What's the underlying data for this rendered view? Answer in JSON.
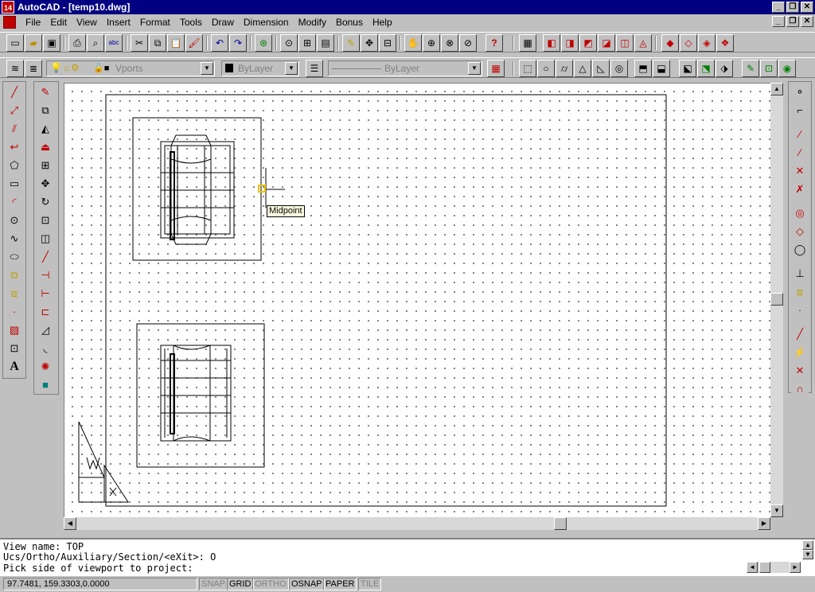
{
  "window": {
    "title": "AutoCAD - [temp10.dwg]",
    "app_icon": "14"
  },
  "menu": [
    "File",
    "Edit",
    "View",
    "Insert",
    "Format",
    "Tools",
    "Draw",
    "Dimension",
    "Modify",
    "Bonus",
    "Help"
  ],
  "layers": {
    "layer_combo_value": "Vports",
    "color_combo_value": "ByLayer",
    "linetype_combo_value": "ByLayer"
  },
  "canvas": {
    "snap_tooltip": "Midpoint"
  },
  "command": {
    "line1": "View name: TOP",
    "line2": "Ucs/Ortho/Auxiliary/Section/<eXit>: O",
    "line3": "Pick side of viewport to project:"
  },
  "status": {
    "coords": "97.7481, 159.3303,0.0000",
    "snap": "SNAP",
    "grid": "GRID",
    "ortho": "ORTHO",
    "osnap": "OSNAP",
    "paper": "PAPER",
    "tile": "TILE"
  }
}
